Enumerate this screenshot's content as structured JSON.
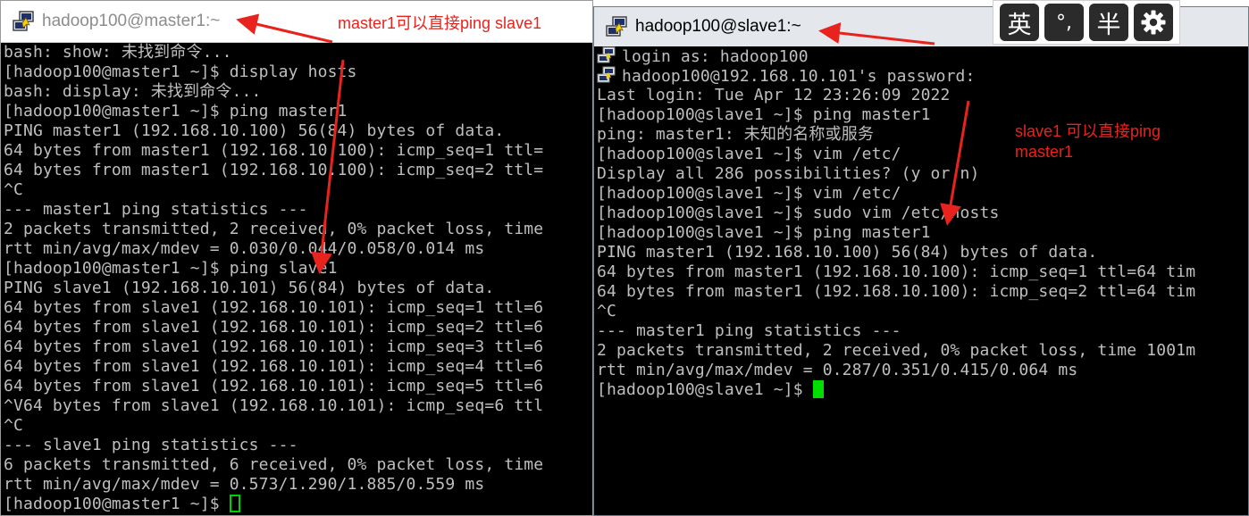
{
  "windows": {
    "master": {
      "title": "hadoop100@master1:~",
      "lines": [
        "bash: show: 未找到命令...",
        "[hadoop100@master1 ~]$ display hosts",
        "bash: display: 未找到命令...",
        "[hadoop100@master1 ~]$ ping master1",
        "PING master1 (192.168.10.100) 56(84) bytes of data.",
        "64 bytes from master1 (192.168.10.100): icmp_seq=1 ttl=",
        "64 bytes from master1 (192.168.10.100): icmp_seq=2 ttl=",
        "^C",
        "--- master1 ping statistics ---",
        "2 packets transmitted, 2 received, 0% packet loss, time",
        "rtt min/avg/max/mdev = 0.030/0.044/0.058/0.014 ms",
        "[hadoop100@master1 ~]$ ping slave1",
        "PING slave1 (192.168.10.101) 56(84) bytes of data.",
        "64 bytes from slave1 (192.168.10.101): icmp_seq=1 ttl=6",
        "64 bytes from slave1 (192.168.10.101): icmp_seq=2 ttl=6",
        "64 bytes from slave1 (192.168.10.101): icmp_seq=3 ttl=6",
        "64 bytes from slave1 (192.168.10.101): icmp_seq=4 ttl=6",
        "64 bytes from slave1 (192.168.10.101): icmp_seq=5 ttl=6",
        "^V64 bytes from slave1 (192.168.10.101): icmp_seq=6 ttl",
        "^C",
        "--- slave1 ping statistics ---",
        "6 packets transmitted, 6 received, 0% packet loss, time",
        "rtt min/avg/max/mdev = 0.573/1.290/1.885/0.559 ms",
        "[hadoop100@master1 ~]$ "
      ]
    },
    "slave": {
      "title": "hadoop100@slave1:~",
      "lines": [
        "login as: hadoop100",
        "hadoop100@192.168.10.101's password:",
        "Last login: Tue Apr 12 23:26:09 2022",
        "[hadoop100@slave1 ~]$ ping master1",
        "ping: master1: 未知的名称或服务",
        "[hadoop100@slave1 ~]$ vim /etc/",
        "Display all 286 possibilities? (y or n)",
        "[hadoop100@slave1 ~]$ vim /etc/",
        "[hadoop100@slave1 ~]$ sudo vim /etc/hosts",
        "[hadoop100@slave1 ~]$ ping master1",
        "PING master1 (192.168.10.100) 56(84) bytes of data.",
        "64 bytes from master1 (192.168.10.100): icmp_seq=1 ttl=64 tim",
        "64 bytes from master1 (192.168.10.100): icmp_seq=2 ttl=64 tim",
        "^C",
        "--- master1 ping statistics ---",
        "2 packets transmitted, 2 received, 0% packet loss, time 1001m",
        "rtt min/avg/max/mdev = 0.287/0.351/0.415/0.064 ms",
        "[hadoop100@slave1 ~]$ "
      ]
    }
  },
  "annotations": {
    "master_note": "master1可以直接ping slave1",
    "slave_note_line1": "slave1 可以直接ping",
    "slave_note_line2": "master1"
  },
  "ime_toolbar": {
    "lang_key": "英",
    "punct_key": "°,",
    "width_key": "半",
    "settings_icon": "gear-icon"
  },
  "colors": {
    "terminal_bg": "#000000",
    "terminal_text": "#bfbfbf",
    "cursor": "#00e000",
    "annotation": "#e8231e",
    "slave_titlebar": "#e4e8ec"
  }
}
